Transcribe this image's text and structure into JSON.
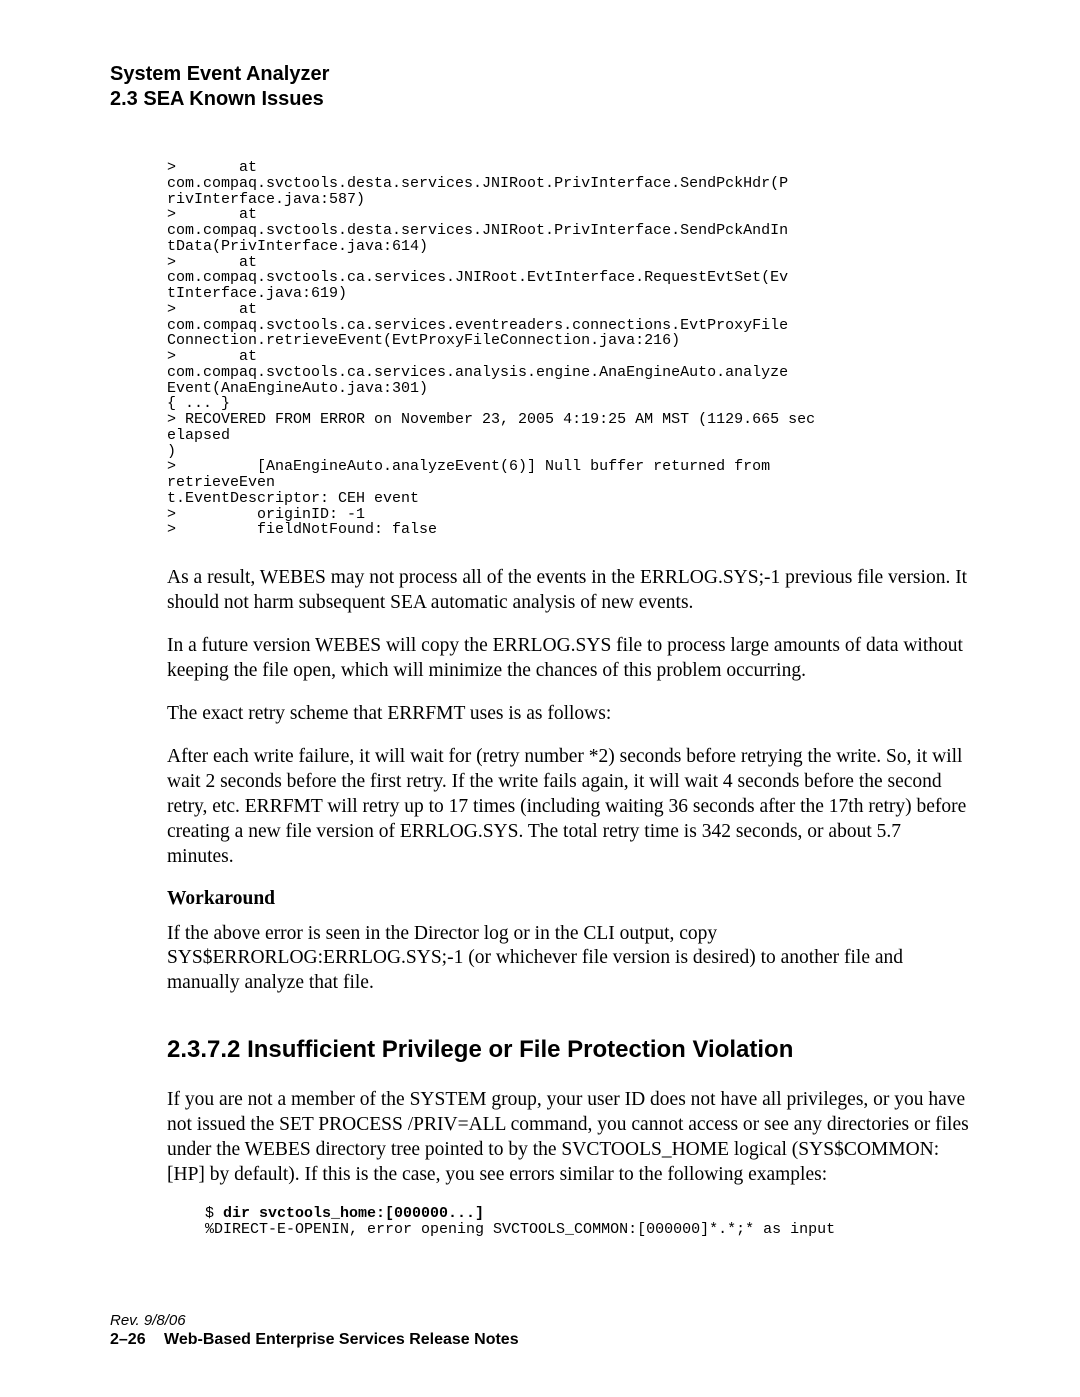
{
  "header": {
    "title1": "System Event Analyzer",
    "title2": "2.3  SEA Known Issues"
  },
  "code1": ">       at\ncom.compaq.svctools.desta.services.JNIRoot.PrivInterface.SendPckHdr(P\nrivInterface.java:587)\n>       at\ncom.compaq.svctools.desta.services.JNIRoot.PrivInterface.SendPckAndIn\ntData(PrivInterface.java:614)\n>       at\ncom.compaq.svctools.ca.services.JNIRoot.EvtInterface.RequestEvtSet(Ev\ntInterface.java:619)\n>       at\ncom.compaq.svctools.ca.services.eventreaders.connections.EvtProxyFile\nConnection.retrieveEvent(EvtProxyFileConnection.java:216)\n>       at\ncom.compaq.svctools.ca.services.analysis.engine.AnaEngineAuto.analyze\nEvent(AnaEngineAuto.java:301)\n{ ... }\n> RECOVERED FROM ERROR on November 23, 2005 4:19:25 AM MST (1129.665 sec\nelapsed\n)\n>         [AnaEngineAuto.analyzeEvent(6)] Null buffer returned from\nretrieveEven\nt.EventDescriptor: CEH event\n>         originID: -1\n>         fieldNotFound: false",
  "para1": "As a result, WEBES may not process all of the events in the ERRLOG.SYS;-1 previous file version. It should not harm subsequent SEA automatic analysis of new events.",
  "para2": "In a future version WEBES will copy the ERRLOG.SYS file to process large amounts of data without keeping the file open, which will minimize the chances of this problem occurring.",
  "para3": "The exact retry scheme that ERRFMT uses is as follows:",
  "para4": "After each write failure, it will wait for (retry number *2) seconds before retrying the write. So, it will wait 2 seconds before the first retry. If the write fails again, it will wait 4 seconds before the second retry, etc. ERRFMT will retry up to 17 times (including waiting 36 seconds after the 17th retry) before creating a new file version of ERRLOG.SYS. The total retry time is 342 seconds, or about 5.7 minutes.",
  "subhead1": "Workaround",
  "para5": "If the above error is seen in the Director log or in the CLI output, copy SYS$ERRORLOG:ERRLOG.SYS;-1 (or whichever file version is desired) to another file and manually analyze that file.",
  "h3_1": "2.3.7.2  Insufficient Privilege or File Protection Violation",
  "para6": "If you are not a member of the SYSTEM group, your user ID does not have all privileges, or you have not issued the SET PROCESS /PRIV=ALL command, you cannot access or see any directories or files under the WEBES directory tree pointed to by the SVCTOOLS_HOME logical (SYS$COMMON:[HP] by default). If this is the case, you see errors similar to the following examples:",
  "code2_prefix": "$ ",
  "code2_bold": "dir svctools_home:[000000...]",
  "code2_line2": "%DIRECT-E-OPENIN, error opening SVCTOOLS_COMMON:[000000]*.*;* as input",
  "footer": {
    "rev": "Rev. 9/8/06",
    "pg": "2–26",
    "title": "Web-Based Enterprise Services    Release Notes"
  }
}
